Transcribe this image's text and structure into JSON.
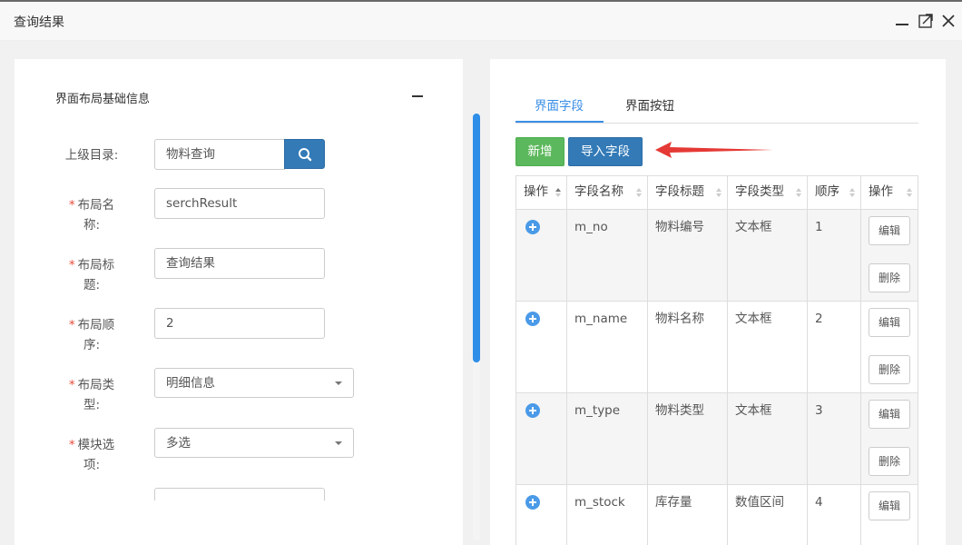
{
  "window": {
    "title": "查询结果"
  },
  "left": {
    "section_title": "界面布局基础信息",
    "fields": [
      {
        "label": "上级目录:",
        "required": false,
        "value": "物料查询"
      },
      {
        "label_lines": [
          "布局名",
          "称:"
        ],
        "required": true,
        "value": "serchResult"
      },
      {
        "label_lines": [
          "布局标",
          "题:"
        ],
        "required": true,
        "value": "查询结果"
      },
      {
        "label_lines": [
          "布局顺",
          "序:"
        ],
        "required": true,
        "value": "2"
      },
      {
        "label_lines": [
          "布局类",
          "型:"
        ],
        "required": true,
        "value": "明细信息"
      },
      {
        "label_lines": [
          "模块选",
          "项:"
        ],
        "required": true,
        "value": "多选"
      }
    ],
    "required_mark": "*"
  },
  "right": {
    "tabs": [
      "界面字段",
      "界面按钮"
    ],
    "active_tab": 0,
    "buttons": {
      "add": "新增",
      "import": "导入字段"
    },
    "columns": [
      "操作",
      "字段名称",
      "字段标题",
      "字段类型",
      "顺序",
      "操作"
    ],
    "rows": [
      {
        "name": "m_no",
        "title": "物料编号",
        "type": "文本框",
        "order": "1"
      },
      {
        "name": "m_name",
        "title": "物料名称",
        "type": "文本框",
        "order": "2"
      },
      {
        "name": "m_type",
        "title": "物料类型",
        "type": "文本框",
        "order": "3"
      },
      {
        "name": "m_stock",
        "title": "库存量",
        "type": "数值区间",
        "order": "4"
      }
    ],
    "row_actions": {
      "edit": "编辑",
      "delete": "删除"
    }
  },
  "colors": {
    "primary": "#337ab7",
    "success": "#5cb85c",
    "tab_active": "#3a8ee6",
    "scroll_thumb": "#2e8ee8",
    "annotation_arrow": "#e53935"
  }
}
